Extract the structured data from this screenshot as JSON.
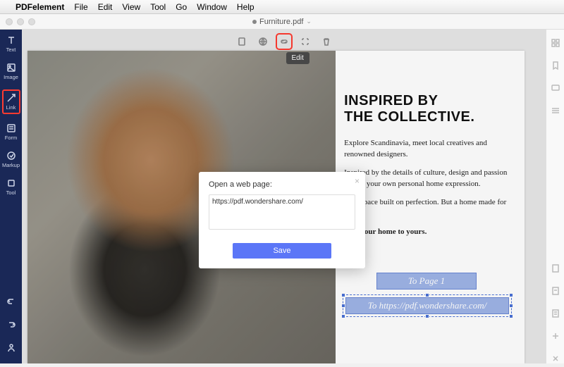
{
  "menubar": {
    "app": "PDFelement",
    "items": [
      "File",
      "Edit",
      "View",
      "Tool",
      "Go",
      "Window",
      "Help"
    ]
  },
  "document": {
    "title": "Furniture.pdf",
    "modified": true
  },
  "sidebar": {
    "items": [
      {
        "label": "Text",
        "name": "text-tool"
      },
      {
        "label": "Image",
        "name": "image-tool"
      },
      {
        "label": "Link",
        "name": "link-tool",
        "selected": true
      },
      {
        "label": "Form",
        "name": "form-tool"
      },
      {
        "label": "Markup",
        "name": "markup-tool"
      },
      {
        "label": "Tool",
        "name": "tool-tool"
      }
    ]
  },
  "toolbar": {
    "tooltip": "Edit"
  },
  "content": {
    "heading_l1": "INSPIRED BY",
    "heading_l2": "THE COLLECTIVE.",
    "p1": "Explore Scandinavia, meet local creatives and renowned designers.",
    "p2": "Inspired by the details of culture, design and passion to find your own personal home expression.",
    "p3": "It's a space built on perfection. But a home made for living.",
    "p4": "From our home to yours.",
    "link1": "To Page 1",
    "link2": "To https://pdf.wondershare.com/"
  },
  "modal": {
    "title": "Open a web page:",
    "value": "https://pdf.wondershare.com/",
    "save": "Save"
  }
}
